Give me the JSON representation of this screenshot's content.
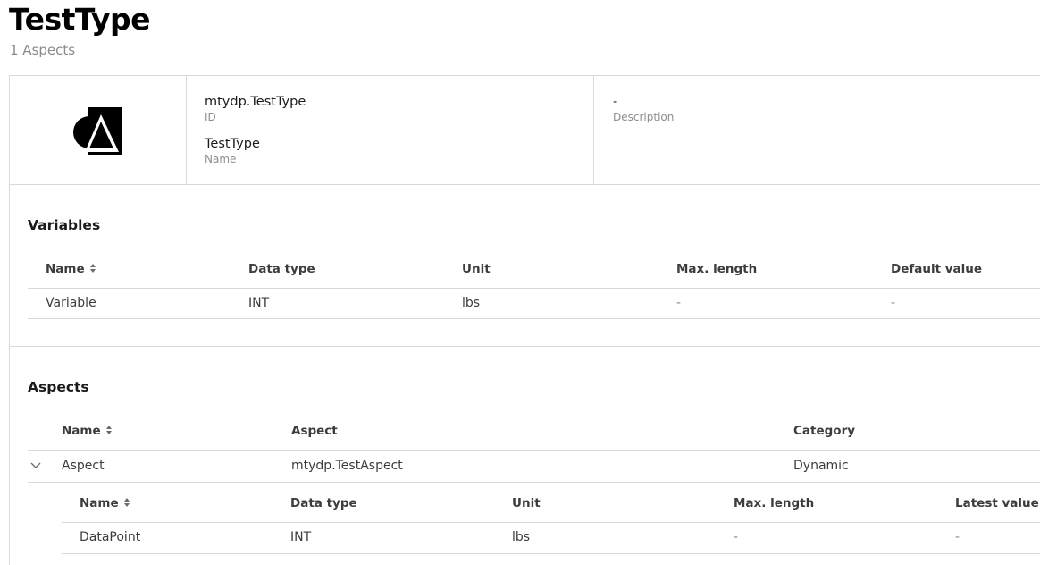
{
  "page": {
    "title": "TestType",
    "subtitle": "1 Aspects"
  },
  "details": {
    "id_value": "mtydp.TestType",
    "id_label": "ID",
    "name_value": "TestType",
    "name_label": "Name",
    "description_value": "-",
    "description_label": "Description"
  },
  "variables": {
    "title": "Variables",
    "columns": [
      "Name",
      "Data type",
      "Unit",
      "Max. length",
      "Default value"
    ],
    "rows": [
      [
        "Variable",
        "INT",
        "lbs",
        "-",
        "-"
      ]
    ]
  },
  "aspects": {
    "title": "Aspects",
    "columns": [
      "Name",
      "Aspect",
      "Category"
    ],
    "rows": [
      [
        "Aspect",
        "mtydp.TestAspect",
        "Dynamic"
      ]
    ],
    "nested": {
      "columns": [
        "Name",
        "Data type",
        "Unit",
        "Max. length",
        "Latest value"
      ],
      "rows": [
        [
          "DataPoint",
          "INT",
          "lbs",
          "-",
          "-"
        ]
      ]
    }
  },
  "icons": {
    "logo": "asset-type-logo-icon",
    "sort": "sort-icon",
    "expand": "chevron-down-icon"
  }
}
